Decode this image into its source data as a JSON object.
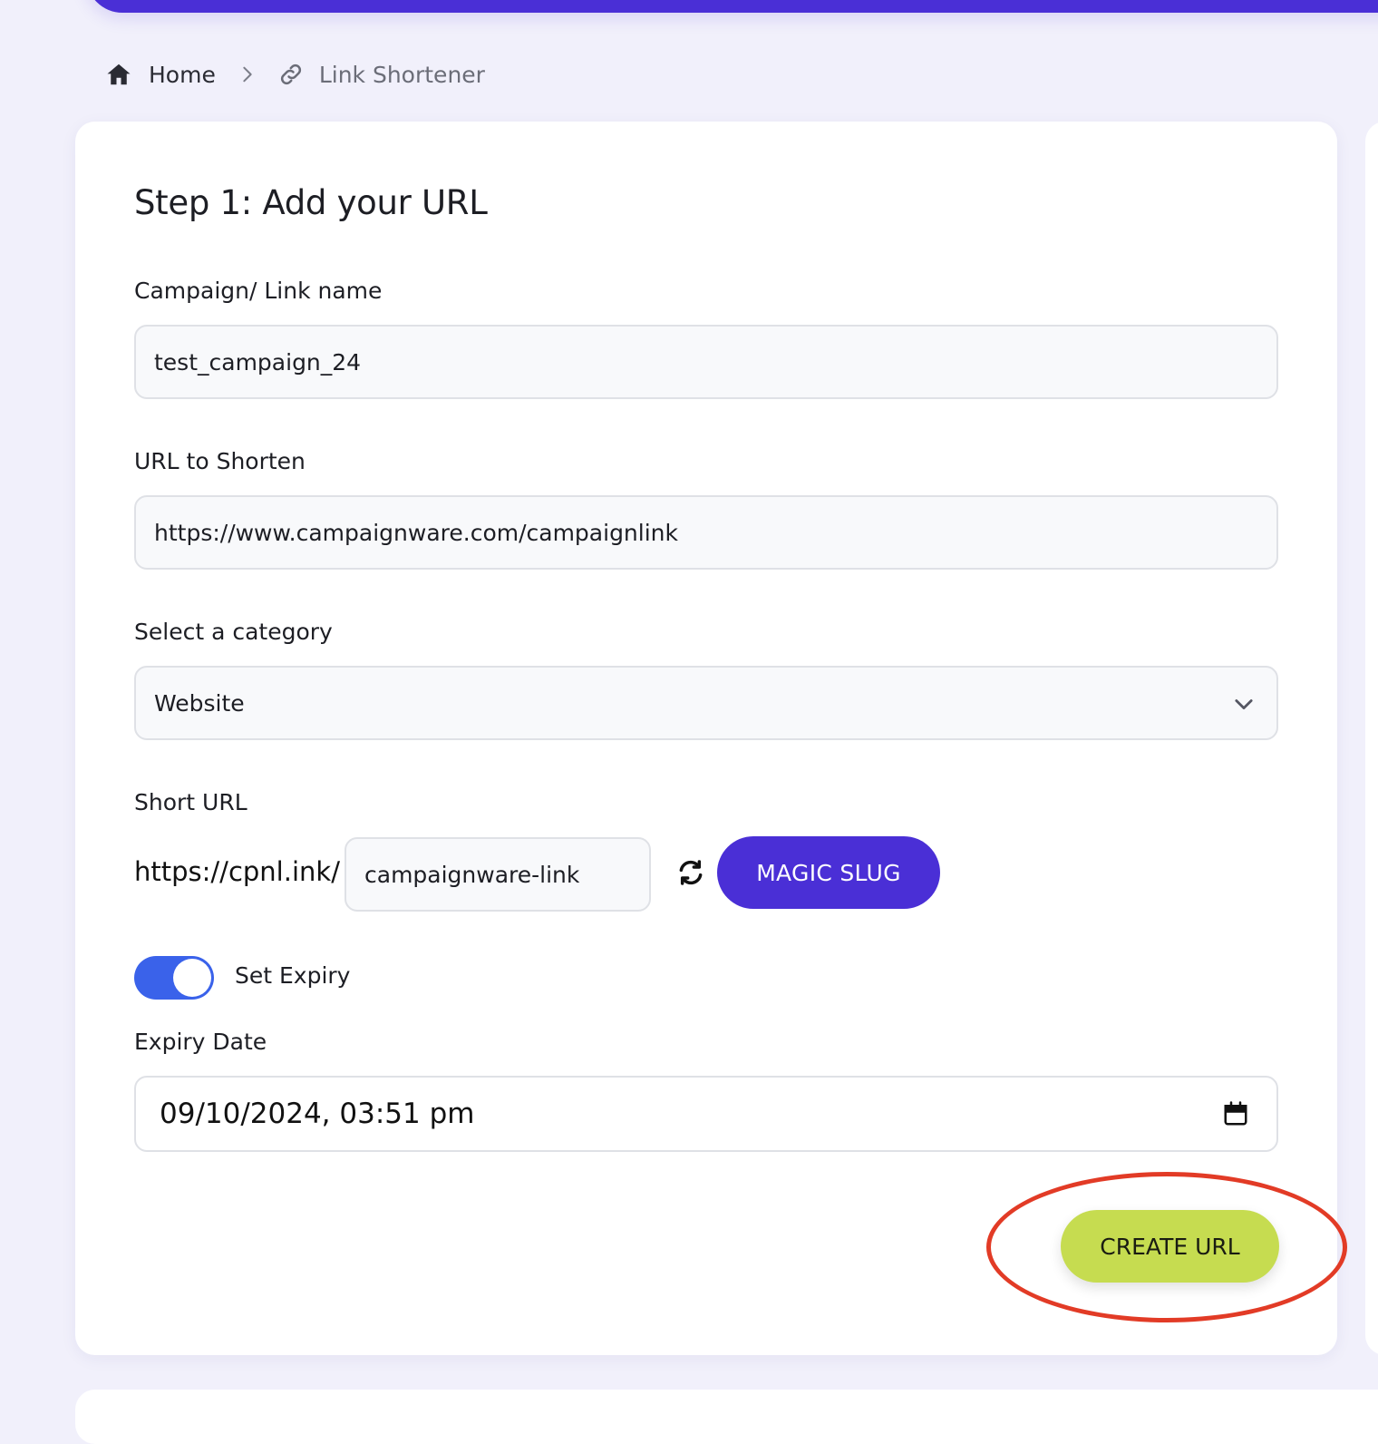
{
  "breadcrumb": {
    "home_label": "Home",
    "current_label": "Link Shortener",
    "icons": [
      "home-icon",
      "chevron-right-icon",
      "link-icon"
    ]
  },
  "form": {
    "title": "Step 1: Add your URL",
    "campaign_label": "Campaign/ Link name",
    "campaign_value": "test_campaign_24",
    "url_label": "URL to Shorten",
    "url_value": "https://www.campaignware.com/campaignlink",
    "category_label": "Select a category",
    "category_value": "Website",
    "short_url_label": "Short URL",
    "short_url_prefix": "https://cpnl.ink/",
    "slug_value": "campaignware-link",
    "magic_slug_label": "MAGIC SLUG",
    "expiry_toggle_label": "Set Expiry",
    "expiry_toggle_on": true,
    "expiry_date_label": "Expiry Date",
    "expiry_date_value": "09/10/2024, 03:51 pm",
    "create_label": "CREATE URL"
  },
  "colors": {
    "brand": "#4a2fd6",
    "toggle": "#3a62ea",
    "create_button": "#c6dc50",
    "annotation": "#e23b26",
    "background": "#f1f0fb"
  }
}
